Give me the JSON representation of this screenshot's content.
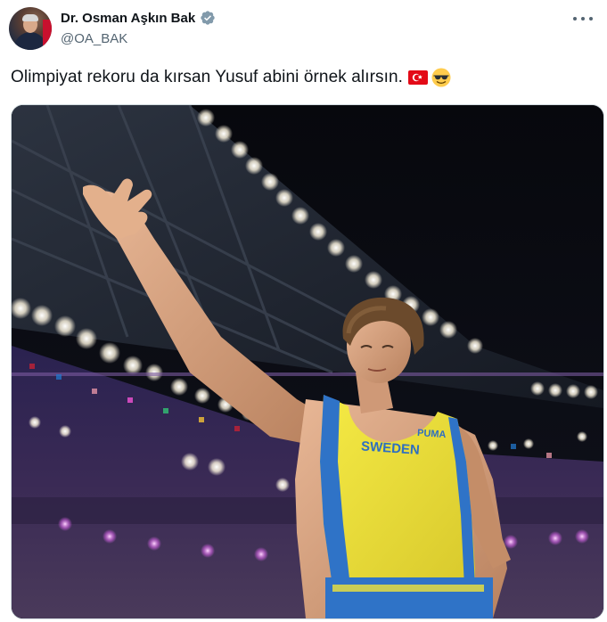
{
  "author": {
    "name": "Dr. Osman Aşkın Bak",
    "handle": "@OA_BAK",
    "verified": true
  },
  "tweet": {
    "text": "Olimpiyat rekoru da kırsan Yusuf abini örnek alırsın.",
    "emojis": [
      "turkish-flag",
      "smiling-face-with-sunglasses"
    ]
  },
  "photo": {
    "jersey_text": "SWEDEN",
    "jersey_color": "#f0e33a",
    "stripe_color": "#2f73c7"
  },
  "colors": {
    "text_primary": "#0f1419",
    "text_secondary": "#536471",
    "verified_badge": "#829aab"
  }
}
